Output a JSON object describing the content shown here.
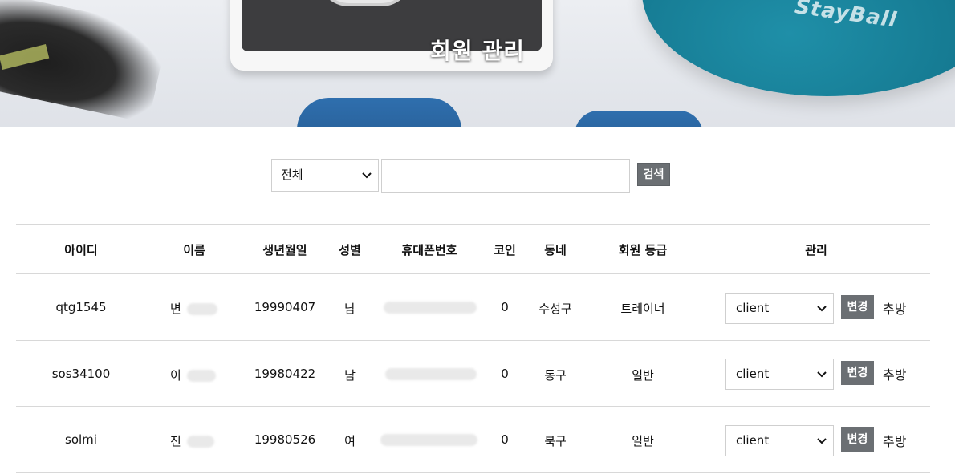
{
  "hero": {
    "title": "회원 관리",
    "ball_text": "StayBall"
  },
  "search": {
    "select_value": "전체",
    "input_value": "",
    "button_label": "검색"
  },
  "table": {
    "headers": [
      "아이디",
      "이름",
      "생년월일",
      "성별",
      "휴대폰번호",
      "코인",
      "동네",
      "회원 등급",
      "관리"
    ],
    "rows": [
      {
        "id": "qtg1545",
        "name": "변",
        "birth": "19990407",
        "gender": "남",
        "phone": "",
        "coin": "0",
        "area": "수성구",
        "grade": "트레이너",
        "role": "client",
        "change_label": "변경",
        "kick_label": "추방"
      },
      {
        "id": "sos34100",
        "name": "이",
        "birth": "19980422",
        "gender": "남",
        "phone": "",
        "coin": "0",
        "area": "동구",
        "grade": "일반",
        "role": "client",
        "change_label": "변경",
        "kick_label": "추방"
      },
      {
        "id": "solmi",
        "name": "진",
        "birth": "19980526",
        "gender": "여",
        "phone": "",
        "coin": "0",
        "area": "북구",
        "grade": "일반",
        "role": "client",
        "change_label": "변경",
        "kick_label": "추방"
      }
    ]
  },
  "colors": {
    "button_bg": "#6b6f73",
    "divider": "#d8d8d8"
  }
}
